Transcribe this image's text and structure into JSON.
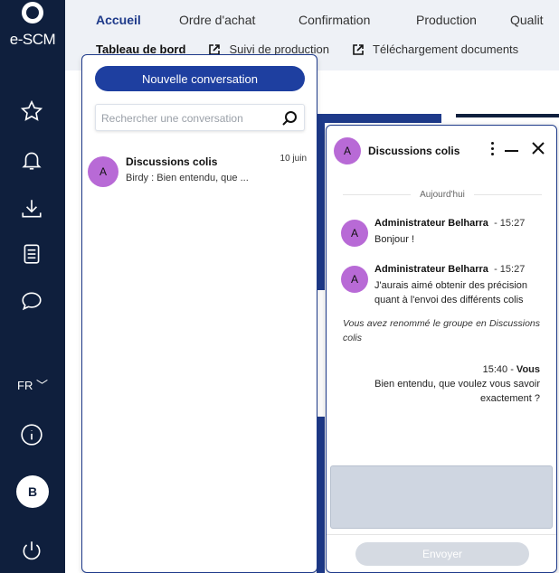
{
  "app": {
    "logo_text": "e-SCM"
  },
  "rail": {
    "icons": [
      "star-icon",
      "bell-icon",
      "download-icon",
      "document-icon",
      "chat-bubble-icon",
      "info-icon",
      "power-icon"
    ],
    "language": "FR",
    "user_initial": "B"
  },
  "topnav": {
    "tabs": [
      "Accueil",
      "Ordre d'achat",
      "Confirmation",
      "Production",
      "Qualit"
    ],
    "active_tab": "Accueil",
    "subtabs": [
      "Tableau de bord",
      "Suivi de production",
      "Téléchargement documents"
    ]
  },
  "conversations": {
    "new_button": "Nouvelle conversation",
    "search_placeholder": "Rechercher une conversation",
    "items": [
      {
        "initial": "A",
        "name": "Discussions colis",
        "date": "10 juin",
        "preview": "Birdy : Bien entendu, que ..."
      }
    ]
  },
  "chat": {
    "title": "Discussions colis",
    "initial": "A",
    "day_label": "Aujourd'hui",
    "messages": [
      {
        "initial": "A",
        "author": "Administrateur Belharra",
        "time": "- 15:27",
        "text": "Bonjour !"
      },
      {
        "initial": "A",
        "author": "Administrateur Belharra",
        "time": "- 15:27",
        "text": "J'aurais aimé obtenir des précision quant à l'envoi des différents colis"
      }
    ],
    "system_message": "Vous avez renommé le groupe en Discussions colis",
    "own_message": {
      "time": "15:40 - ",
      "author": "Vous",
      "text": "Bien entendu, que voulez vous savoir exactement ?"
    },
    "send_label": "Envoyer"
  },
  "colors": {
    "rail": "#0f1f3d",
    "accent": "#1e3fa0",
    "avatar": "#b86ad6"
  }
}
